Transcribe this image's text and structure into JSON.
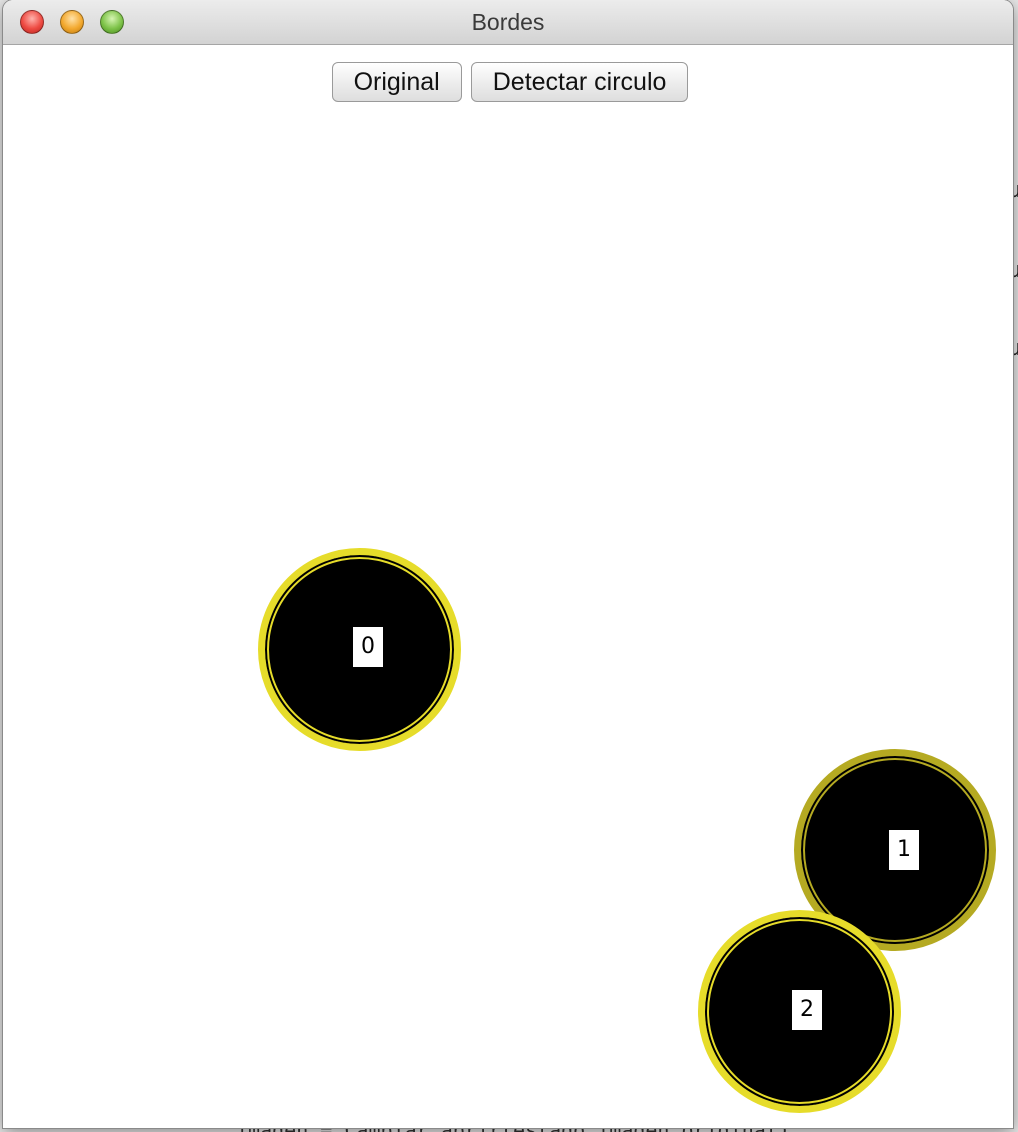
{
  "window": {
    "title": "Bordes"
  },
  "toolbar": {
    "original_label": "Original",
    "detect_label": "Detectar circulo"
  },
  "circles": [
    {
      "label": "0"
    },
    {
      "label": "1"
    },
    {
      "label": "2"
    }
  ],
  "colors": {
    "circle_fill": "#000000",
    "circle_outline": "#e6dc2a",
    "canvas_background": "#ffffff"
  }
}
